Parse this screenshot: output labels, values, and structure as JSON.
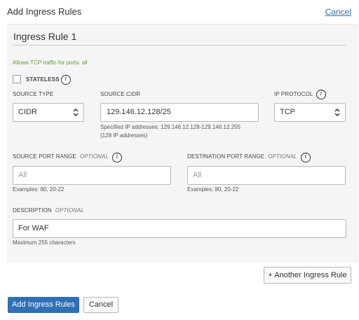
{
  "header": {
    "title": "Add Ingress Rules",
    "cancel_label": "Cancel"
  },
  "rule": {
    "title": "Ingress Rule 1",
    "allows_text": "Allows TCP traffic for ports: all",
    "stateless_label": "STATELESS",
    "stateless_checked": false,
    "info_glyph": "i",
    "source_type": {
      "label": "SOURCE TYPE",
      "value": "CIDR"
    },
    "source_cidr": {
      "label": "SOURCE CIDR",
      "value": "129.146.12.128/25",
      "hint_line1": "Specified IP addresses: 129.146.12.128-129.146.12.255",
      "hint_line2": "(128 IP addresses)"
    },
    "ip_protocol": {
      "label": "IP PROTOCOL",
      "value": "TCP"
    },
    "source_port": {
      "label": "SOURCE PORT RANGE",
      "optional": "OPTIONAL",
      "placeholder": "All",
      "hint": "Examples: 80, 20-22"
    },
    "dest_port": {
      "label": "DESTINATION PORT RANGE",
      "optional": "OPTIONAL",
      "placeholder": "All",
      "hint": "Examples: 80, 20-22"
    },
    "description": {
      "label": "DESCRIPTION",
      "optional": "OPTIONAL",
      "value": "For WAF",
      "hint": "Maximum 255 characters"
    }
  },
  "buttons": {
    "another_rule": "+ Another Ingress Rule",
    "add_rules": "Add Ingress Rules",
    "cancel": "Cancel"
  },
  "colors": {
    "accent": "#2f6fb5",
    "link": "#2f6fad",
    "success_text": "#5b9f2f",
    "panel_bg": "#f5f5f5"
  }
}
